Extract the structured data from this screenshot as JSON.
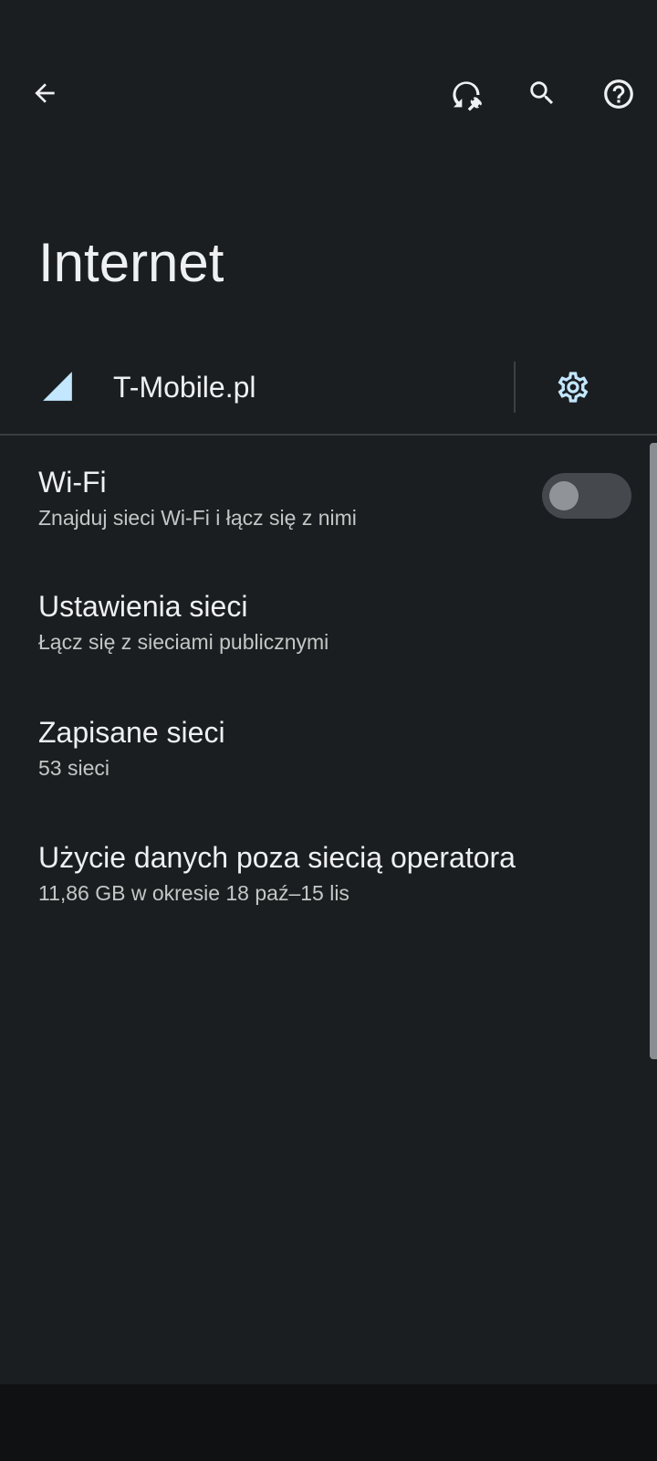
{
  "toolbar": {
    "back_icon": "arrow-back-icon",
    "tools_icon": "network-reset-icon",
    "search_icon": "search-icon",
    "help_icon": "help-icon"
  },
  "page": {
    "title": "Internet"
  },
  "carrier": {
    "name": "T-Mobile.pl",
    "signal_icon": "cellular-signal-icon",
    "settings_icon": "gear-icon",
    "accent_color": "#c2e7ff"
  },
  "settings": {
    "wifi": {
      "title": "Wi-Fi",
      "subtitle": "Znajduj sieci Wi-Fi i łącz się z nimi",
      "enabled": false
    },
    "network": {
      "title": "Ustawienia sieci",
      "subtitle": "Łącz się z sieciami publicznymi"
    },
    "saved": {
      "title": "Zapisane sieci",
      "subtitle": "53 sieci"
    },
    "usage": {
      "title": "Użycie danych poza siecią operatora",
      "subtitle": "11,86 GB w okresie 18 paź–15 lis"
    }
  },
  "colors": {
    "background": "#1b1e21",
    "text_primary": "#eef0f2",
    "text_secondary": "#c4c7c5",
    "navbar": "#0f1112"
  }
}
